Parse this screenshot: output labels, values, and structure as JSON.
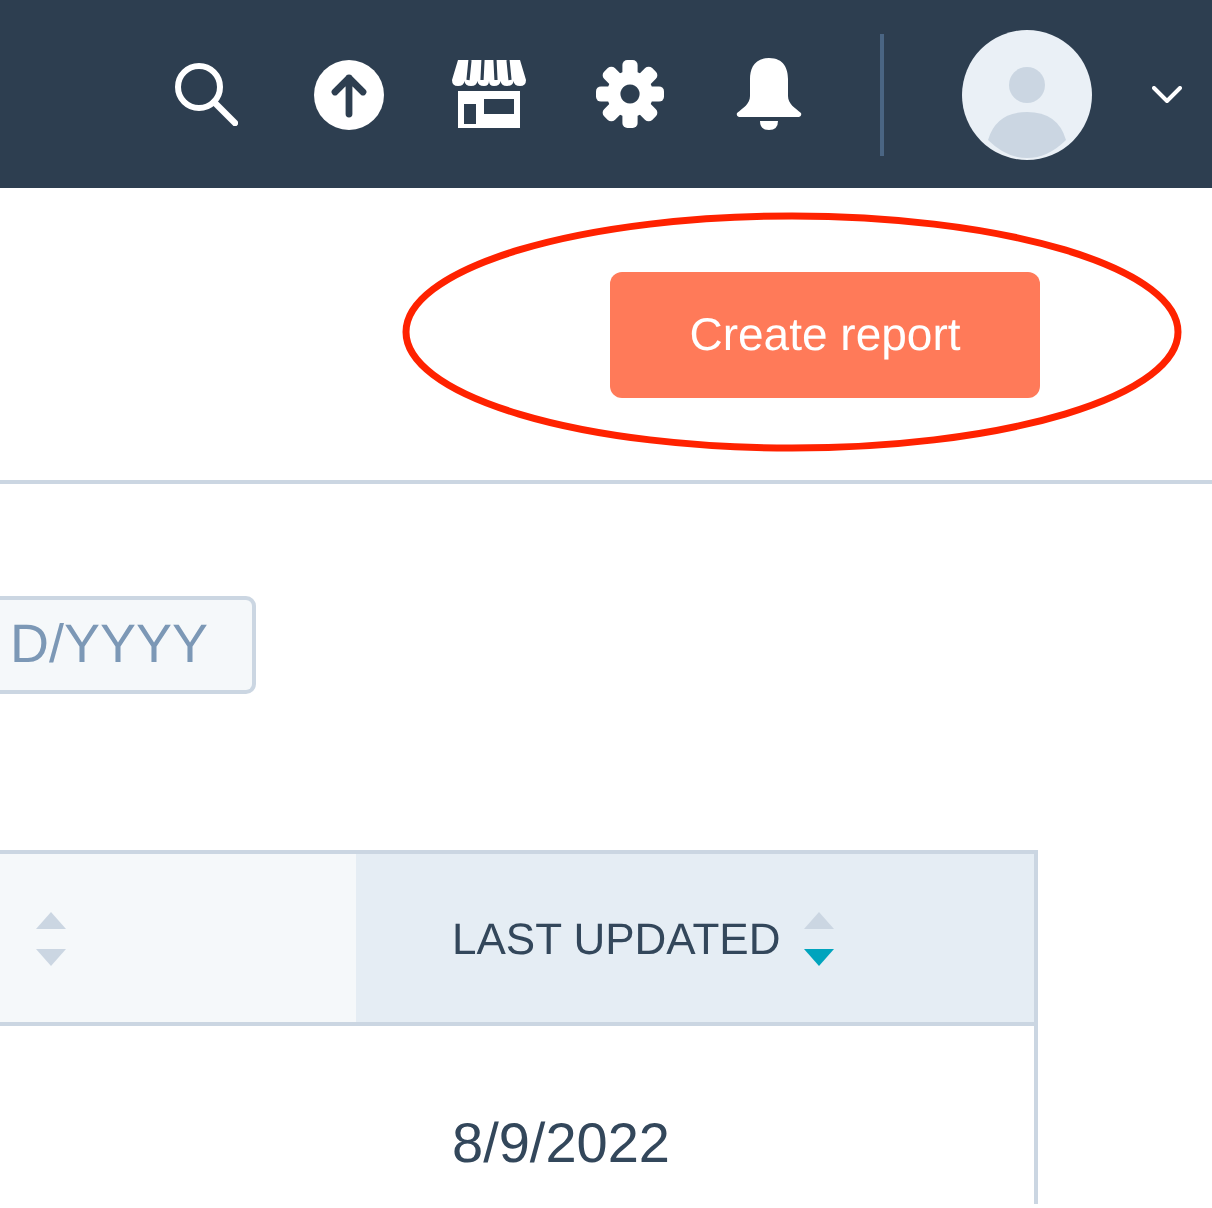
{
  "header": {
    "primary_button": "Create report"
  },
  "annotations": [
    {
      "kind": "ellipse"
    }
  ],
  "filters": {
    "date_field": {
      "placeholder": "D/YYYY"
    }
  },
  "table": {
    "columns": [
      {
        "sorted_ascending": false,
        "sorted_descending": false
      },
      {
        "label": "LAST UPDATED",
        "sorted_ascending": false,
        "sorted_descending": true
      }
    ],
    "rows": [
      {
        "last_updated": "8/9/2022"
      }
    ]
  }
}
